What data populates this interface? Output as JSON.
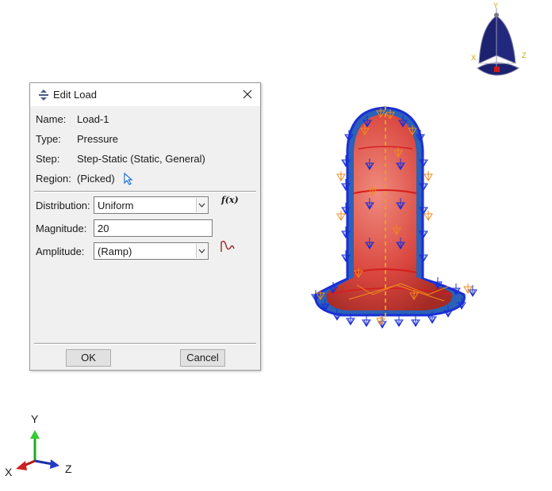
{
  "dialog": {
    "title": "Edit Load",
    "name_label": "Name:",
    "name_value": "Load-1",
    "type_label": "Type:",
    "type_value": "Pressure",
    "step_label": "Step:",
    "step_value": "Step-Static (Static, General)",
    "region_label": "Region:",
    "region_value": "(Picked)",
    "distribution_label": "Distribution:",
    "distribution_value": "Uniform",
    "fx_label": "f(x)",
    "magnitude_label": "Magnitude:",
    "magnitude_value": "20",
    "amplitude_label": "Amplitude:",
    "amplitude_value": "(Ramp)",
    "ok_label": "OK",
    "cancel_label": "Cancel"
  },
  "triad": {
    "x": "X",
    "y": "Y",
    "z": "Z"
  },
  "view_cube": {
    "x": "X",
    "y": "Y",
    "z": "Z"
  },
  "colors": {
    "model_red": "#d9473f",
    "arrow_blue": "#1a2fd6",
    "arrow_orange": "#f08a1c",
    "cube_navy": "#1c2270"
  }
}
